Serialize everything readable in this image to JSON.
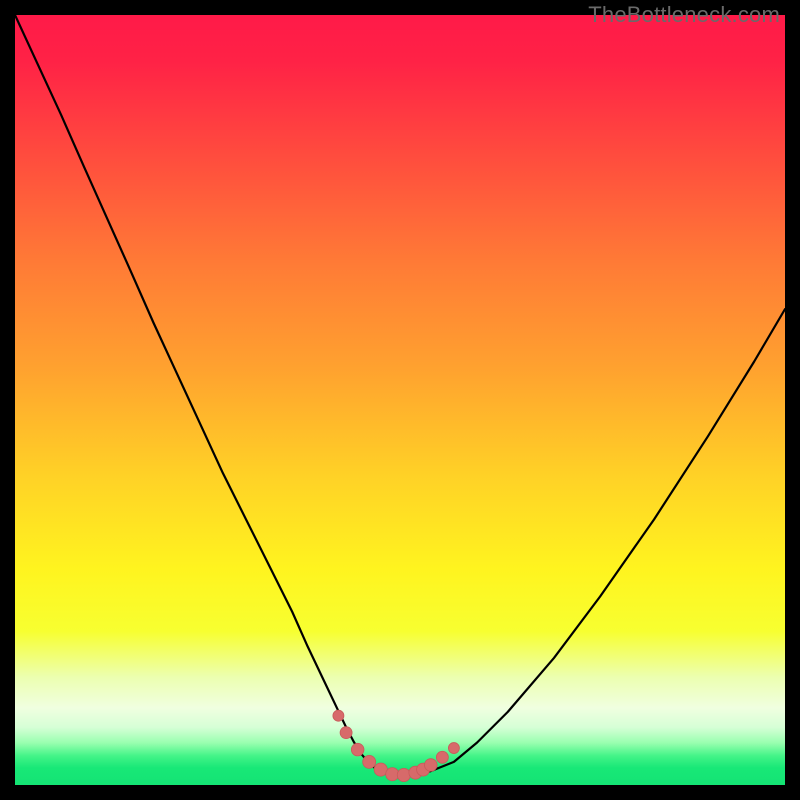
{
  "watermark": {
    "text": "TheBottleneck.com"
  },
  "colors": {
    "black": "#000000",
    "gradient_stops": [
      {
        "offset": 0.0,
        "color": "#ff1a48"
      },
      {
        "offset": 0.06,
        "color": "#ff2246"
      },
      {
        "offset": 0.18,
        "color": "#ff4b3e"
      },
      {
        "offset": 0.32,
        "color": "#ff7a36"
      },
      {
        "offset": 0.46,
        "color": "#ffa22f"
      },
      {
        "offset": 0.6,
        "color": "#ffd226"
      },
      {
        "offset": 0.72,
        "color": "#fff41f"
      },
      {
        "offset": 0.8,
        "color": "#f7ff30"
      },
      {
        "offset": 0.86,
        "color": "#ecffb0"
      },
      {
        "offset": 0.9,
        "color": "#f0ffe0"
      },
      {
        "offset": 0.925,
        "color": "#d6ffd6"
      },
      {
        "offset": 0.945,
        "color": "#9affb0"
      },
      {
        "offset": 0.962,
        "color": "#44f488"
      },
      {
        "offset": 0.978,
        "color": "#18e877"
      },
      {
        "offset": 1.0,
        "color": "#14e374"
      }
    ],
    "curve_stroke": "#000000",
    "marker_fill": "#d76a6a",
    "marker_stroke": "#c85a5a"
  },
  "chart_data": {
    "type": "line",
    "title": "",
    "xlabel": "",
    "ylabel": "",
    "xlim": [
      0,
      100
    ],
    "ylim": [
      0,
      100
    ],
    "grid": false,
    "legend": false,
    "series": [
      {
        "name": "bottleneck-curve",
        "x": [
          0,
          3,
          6,
          9,
          12,
          15,
          18,
          21,
          24,
          27,
          30,
          33,
          36,
          38,
          40,
          42,
          43,
          44,
          45,
          46,
          47,
          48,
          49,
          50,
          52,
          54,
          57,
          60,
          64,
          70,
          76,
          83,
          90,
          96,
          100
        ],
        "y": [
          100,
          93.5,
          87,
          80.2,
          73.5,
          66.8,
          60,
          53.5,
          47,
          40.5,
          34.5,
          28.5,
          22.5,
          18,
          13.8,
          9.6,
          7.5,
          5.6,
          4.0,
          2.8,
          2.0,
          1.5,
          1.3,
          1.3,
          1.4,
          1.8,
          3.0,
          5.5,
          9.5,
          16.5,
          24.5,
          34.5,
          45.3,
          55.0,
          61.8
        ]
      }
    ],
    "markers": {
      "name": "valley-markers",
      "x": [
        42.0,
        43.0,
        44.5,
        46.0,
        47.5,
        49.0,
        50.5,
        52.0,
        53.0,
        54.0,
        55.5,
        57.0
      ],
      "y": [
        9.0,
        6.8,
        4.6,
        3.0,
        2.0,
        1.4,
        1.3,
        1.6,
        2.0,
        2.6,
        3.6,
        4.8
      ],
      "r": [
        5.5,
        6.0,
        6.3,
        6.5,
        6.6,
        6.6,
        6.6,
        6.5,
        6.5,
        6.3,
        6.0,
        5.5
      ]
    }
  }
}
